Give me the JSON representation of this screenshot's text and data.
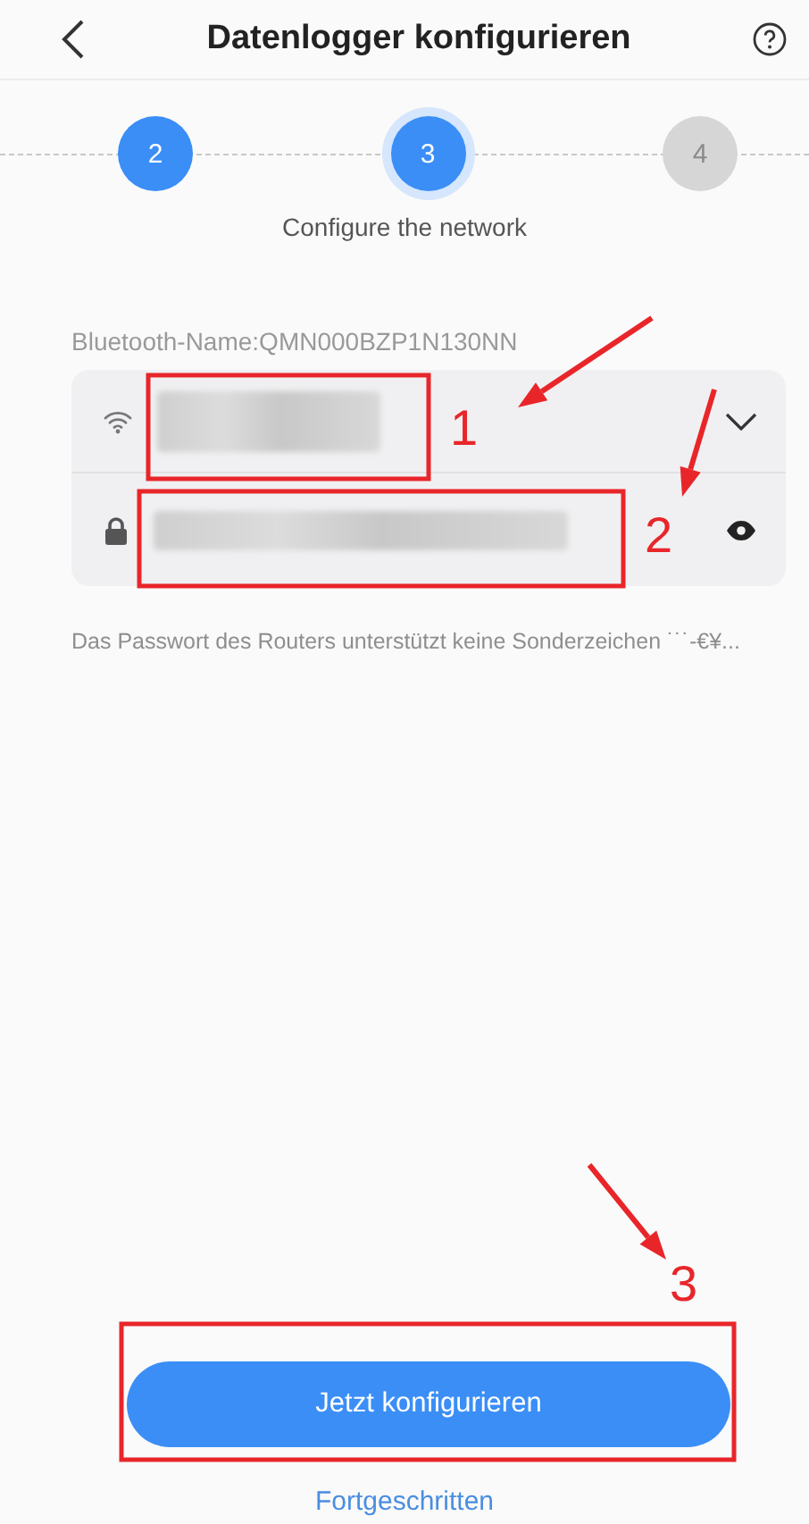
{
  "header": {
    "title": "Datenlogger konfigurieren"
  },
  "steps": [
    {
      "label": "2",
      "done": true,
      "selected": false
    },
    {
      "label": "3",
      "done": false,
      "selected": true
    },
    {
      "label": "4",
      "done": false,
      "selected": false
    }
  ],
  "step_caption": "Configure the network",
  "bluetooth_name": "Bluetooth-Name:QMN000BZP1N130NN",
  "fields": [
    {
      "kind": "wifi"
    },
    {
      "kind": "password"
    }
  ],
  "hint": "Das Passwort des Routers unterstützt keine Sonderzeichen ˙˙˙-€¥...",
  "primary_button": "Jetzt konfigurieren",
  "secondary_link": "Fortgeschritten",
  "annotations": [
    {
      "number": "1"
    },
    {
      "number": "2"
    },
    {
      "number": "3"
    }
  ]
}
